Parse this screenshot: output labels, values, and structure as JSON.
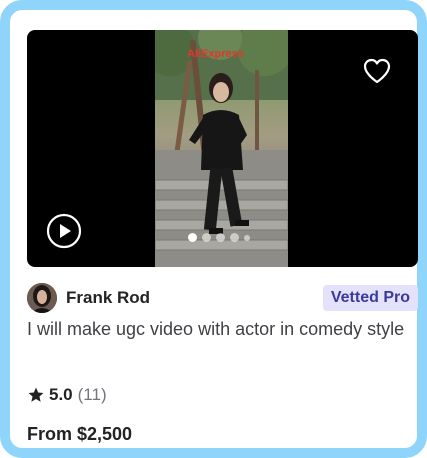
{
  "media": {
    "watermark": "fiv",
    "overlay_text": "AliExpress",
    "slide_count": 5,
    "active_slide": 1
  },
  "seller": {
    "name": "Frank Rod",
    "badge": "Vetted Pro"
  },
  "gig": {
    "title": "I will make ugc video with actor in comedy style"
  },
  "rating": {
    "score": "5.0",
    "count": "(11)"
  },
  "price": {
    "label": "From $2,500"
  },
  "icons": {
    "favorite": "heart-icon",
    "play": "play-icon",
    "rating": "star-icon"
  },
  "colors": {
    "frame_border": "#8fd4fb",
    "badge_bg": "#e4e2fb",
    "badge_text": "#3b3a9a",
    "text_primary": "#222325",
    "text_secondary": "#404145",
    "text_muted": "#74767e"
  }
}
